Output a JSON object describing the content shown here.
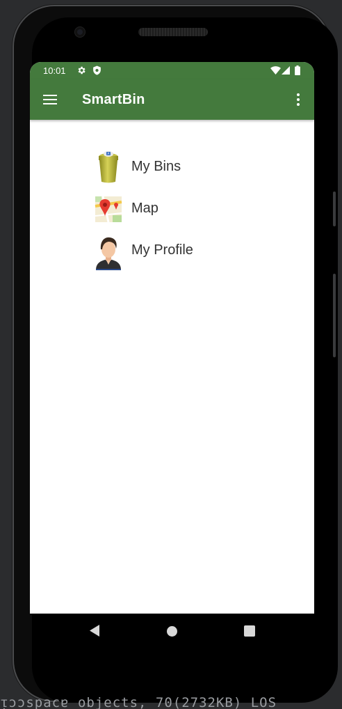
{
  "status_bar": {
    "time": "10:01",
    "background": "#447a3d"
  },
  "app_bar": {
    "title": "SmartBin",
    "background": "#447a3d"
  },
  "menu": {
    "items": [
      {
        "label": "My Bins",
        "icon": "trash-bin-icon"
      },
      {
        "label": "Map",
        "icon": "map-pin-icon"
      },
      {
        "label": "My Profile",
        "icon": "profile-avatar-icon"
      }
    ]
  },
  "console": {
    "text": "ᴉɔɔspacɐ objects, 70(2732KB) LOS"
  }
}
